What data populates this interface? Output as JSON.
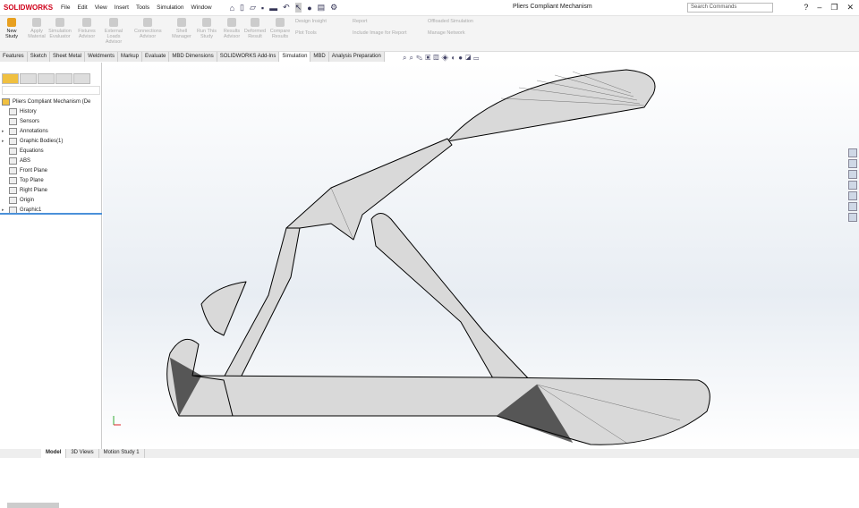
{
  "app": {
    "logo": "SOLIDWORKS",
    "title": "Pliers Compliant Mechanism",
    "search_placeholder": "Search Commands"
  },
  "menu": [
    "File",
    "Edit",
    "View",
    "Insert",
    "Tools",
    "Simulation",
    "Window"
  ],
  "ribbon": {
    "new_study": "New Study",
    "buttons": [
      "Apply Material",
      "Simulation Evaluator",
      "Fixtures Advisor",
      "External Loads Advisor",
      "Connections Advisor",
      "Shell Manager",
      "Run This Study",
      "Results Advisor",
      "Deformed Result",
      "Compare Results"
    ],
    "small": [
      "Design Insight",
      "Plot Tools",
      "Report",
      "Include Image for Report",
      "Offloaded Simulation",
      "Manage Network"
    ]
  },
  "tabs": [
    "Features",
    "Sketch",
    "Sheet Metal",
    "Weldments",
    "Markup",
    "Evaluate",
    "MBD Dimensions",
    "SOLIDWORKS Add-Ins",
    "Simulation",
    "MBD",
    "Analysis Preparation"
  ],
  "active_tab": "Simulation",
  "tree": {
    "root": "Pliers Compliant Mechanism  (De",
    "items": [
      {
        "label": "History",
        "exp": false
      },
      {
        "label": "Sensors",
        "exp": false
      },
      {
        "label": "Annotations",
        "exp": true
      },
      {
        "label": "Graphic Bodies(1)",
        "exp": true
      },
      {
        "label": "Equations",
        "exp": false
      },
      {
        "label": "ABS",
        "exp": false
      },
      {
        "label": "Front Plane",
        "exp": false
      },
      {
        "label": "Top Plane",
        "exp": false
      },
      {
        "label": "Right Plane",
        "exp": false
      },
      {
        "label": "Origin",
        "exp": false
      },
      {
        "label": "Graphic1",
        "exp": true
      }
    ]
  },
  "bottom_tabs": [
    "Model",
    "3D Views",
    "Motion Study 1"
  ],
  "active_bottom": "Model"
}
